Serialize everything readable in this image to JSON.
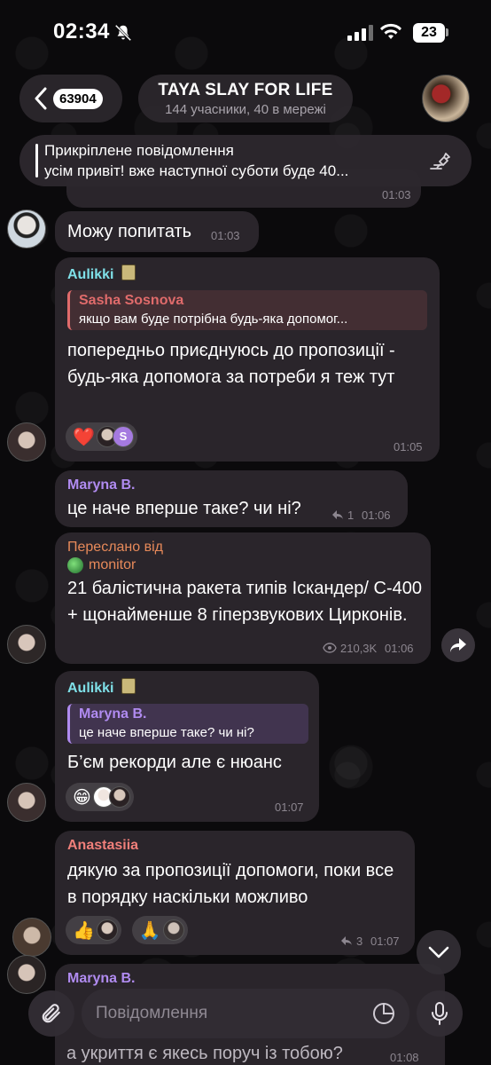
{
  "status": {
    "time": "02:34",
    "battery": "23"
  },
  "header": {
    "back_count": "63904",
    "title": "TAYA SLAY FOR LIFE",
    "subtitle": "144 учасники, 40 в мережі"
  },
  "pinned": {
    "title": "Прикріплене повідомлення",
    "text": "усім привіт! вже наступної суботи буде 40..."
  },
  "colors": {
    "background": "#0b0a0c",
    "bubble": "#2a252b",
    "aulikki": "#7fe0e8",
    "maryna": "#b08bf0",
    "sasha": "#e06b6b",
    "forwarded": "#e88a5a",
    "anastasiia": "#f07f7a"
  },
  "messages": {
    "m0": {
      "time": "01:03"
    },
    "m1": {
      "text": "Можу попитать",
      "time": "01:03"
    },
    "m2": {
      "sender": "Aulikki",
      "reply_name": "Sasha Sosnova",
      "reply_text": "якщо вам буде потрібна будь-яка допомог...",
      "text": "попередньо приєднуюсь до пропозиції - будь-яка допомога за потреби я теж тут",
      "time": "01:05",
      "reaction_emoji": "❤️",
      "reaction_letter": "S"
    },
    "m3": {
      "sender": "Maryna B.",
      "text": "це наче вперше таке? чи ні?",
      "replies": "1",
      "time": "01:06"
    },
    "m4": {
      "forward_label": "Переслано від",
      "forward_source": "monitor",
      "text": "21 балістична ракета типів Іскандер/ С-400 + щонайменше 8 гіперзвукових Цирконів.",
      "views": "210,3K",
      "time": "01:06"
    },
    "m5": {
      "sender": "Aulikki",
      "reply_name": "Maryna B.",
      "reply_text": "це наче вперше таке? чи ні?",
      "text": "Б’єм рекорди але є нюанс",
      "time": "01:07",
      "reaction_emoji": "😁"
    },
    "m6": {
      "sender": "Anastasiia",
      "text": "дякую за пропозиції допомоги, поки все в порядку наскільки можливо",
      "reaction1": "👍",
      "reaction2": "🙏",
      "replies": "3",
      "time": "01:07"
    },
    "m7": {
      "sender": "Maryna B.",
      "text": "а укриття є якесь поруч із тобою?",
      "time": "01:08"
    }
  },
  "input": {
    "placeholder": "Повідомлення"
  },
  "icons": [
    "bell-slash-icon",
    "signal-icon",
    "wifi-icon",
    "battery-icon",
    "chevron-left-icon",
    "unpin-icon",
    "share-icon",
    "chevron-down-icon",
    "paperclip-icon",
    "sticker-icon",
    "mic-icon",
    "eye-icon",
    "reply-icon"
  ]
}
